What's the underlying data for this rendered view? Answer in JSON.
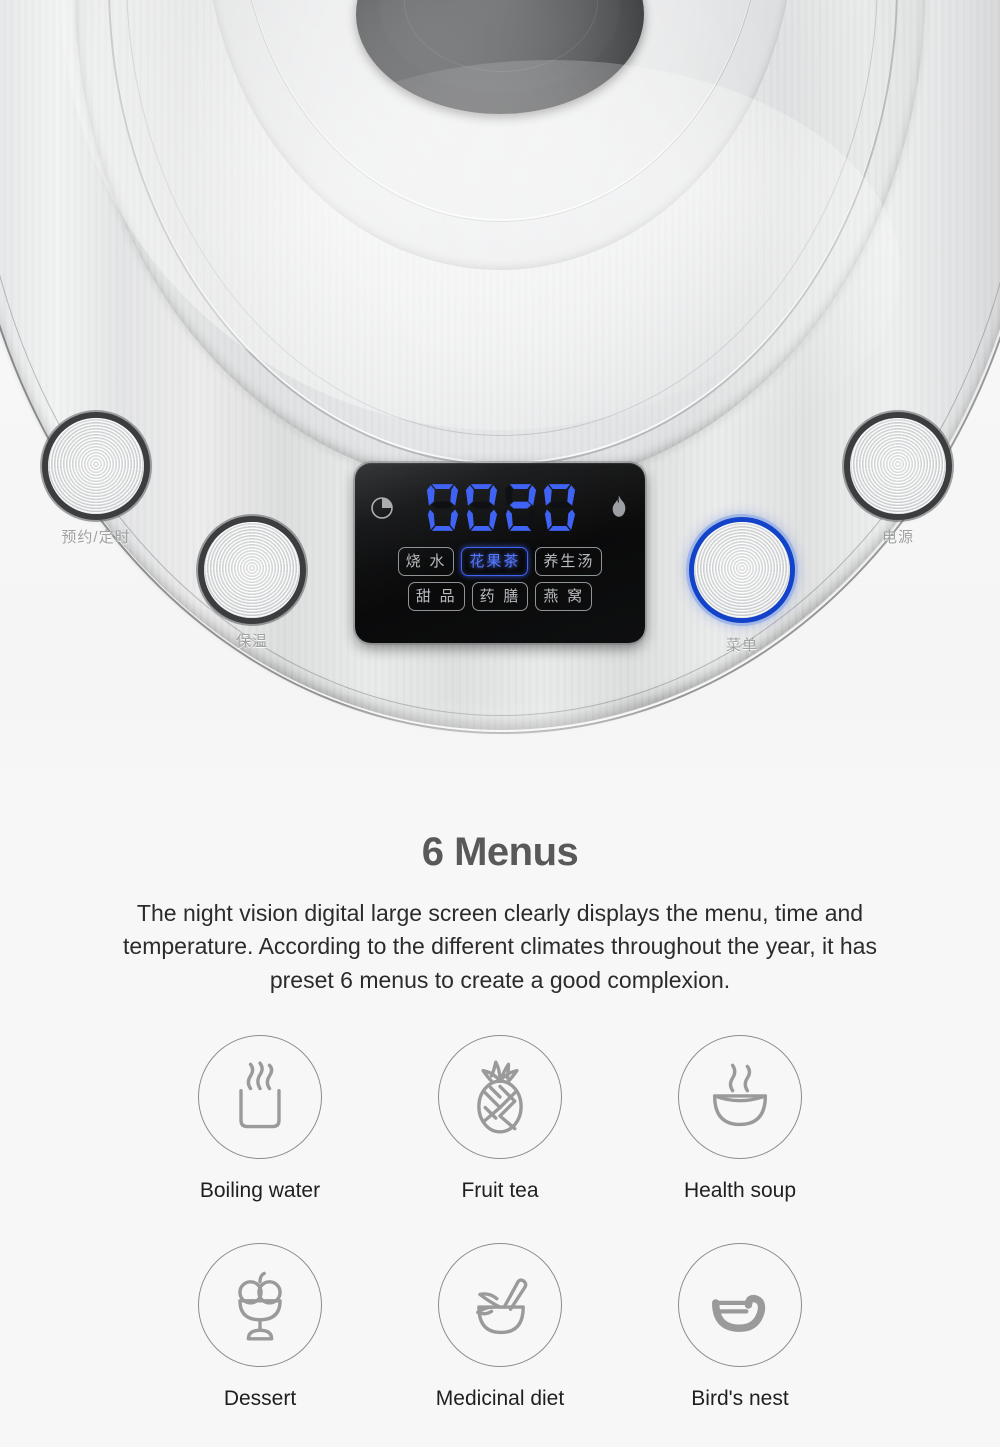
{
  "product_panel": {
    "lcd": {
      "display_value": "0020",
      "left_icon": "clock-icon",
      "right_icon": "flame-icon",
      "menu_pills_row1": [
        {
          "label": "烧 水",
          "active": false
        },
        {
          "label": "花果茶",
          "active": true
        },
        {
          "label": "养生汤",
          "active": false
        }
      ],
      "menu_pills_row2": [
        {
          "label": "甜 品",
          "active": false
        },
        {
          "label": "药 膳",
          "active": false
        },
        {
          "label": "燕 窝",
          "active": false
        }
      ],
      "active_color": "#3f63f4",
      "inactive_color": "#b9bcc0"
    },
    "buttons": [
      {
        "id": "timer",
        "label": "预约/定时",
        "ring": "dark"
      },
      {
        "id": "keepwarm",
        "label": "保温",
        "ring": "dark"
      },
      {
        "id": "menu",
        "label": "菜单",
        "ring": "blue"
      },
      {
        "id": "power",
        "label": "电源",
        "ring": "dark"
      }
    ]
  },
  "content": {
    "headline": "6 Menus",
    "description": "The night vision digital large screen clearly displays the menu, time and temperature. According to the different climates throughout the year, it has preset 6 menus to create a good complexion.",
    "headline_color": "#595959",
    "text_color": "#2b2b2b"
  },
  "features": [
    {
      "label": "Boiling water",
      "icon": "steaming-cup-icon"
    },
    {
      "label": "Fruit tea",
      "icon": "pineapple-icon"
    },
    {
      "label": "Health soup",
      "icon": "steaming-bowl-icon"
    },
    {
      "label": "Dessert",
      "icon": "ice-cream-sundae-icon"
    },
    {
      "label": "Medicinal diet",
      "icon": "mortar-pestle-icon"
    },
    {
      "label": "Bird's nest",
      "icon": "birds-nest-icon"
    }
  ]
}
